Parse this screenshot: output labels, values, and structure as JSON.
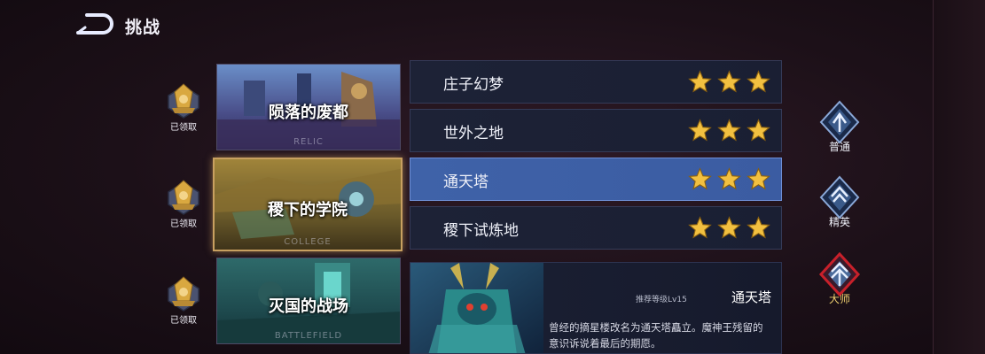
{
  "header": {
    "title": "挑战",
    "back_icon": "back-arrow-icon"
  },
  "rewards": [
    {
      "label": "已领取"
    },
    {
      "label": "已领取"
    },
    {
      "label": "已领取"
    }
  ],
  "chapters": [
    {
      "name": "陨落的废都",
      "subtitle": "RELIC"
    },
    {
      "name": "稷下的学院",
      "subtitle": "COLLEGE",
      "active": true
    },
    {
      "name": "灭国的战场",
      "subtitle": "BATTLEFIELD"
    }
  ],
  "levels": [
    {
      "name": "庄子幻梦",
      "stars": 3
    },
    {
      "name": "世外之地",
      "stars": 3
    },
    {
      "name": "通天塔",
      "stars": 3,
      "selected": true
    },
    {
      "name": "稷下试炼地",
      "stars": 3
    }
  ],
  "detail": {
    "recommended": "推荐等级Lv15",
    "name": "通天塔",
    "description": "曾经的摘星楼改名为通天塔矗立。魔神王残留的意识诉说着最后的期愿。"
  },
  "difficulty": [
    {
      "label": "普通"
    },
    {
      "label": "精英"
    },
    {
      "label": "大师",
      "selected": true
    }
  ],
  "colors": {
    "accent": "#3f62a8",
    "star": "#f2c040",
    "active_border": "#c8a060",
    "master": "#c8202a"
  }
}
